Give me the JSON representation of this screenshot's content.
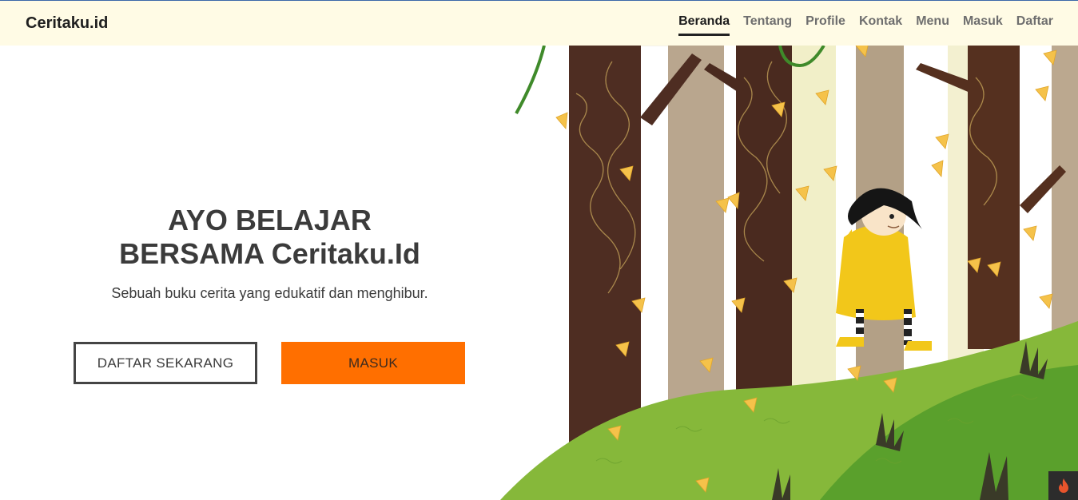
{
  "brand": "Ceritaku.id",
  "nav": {
    "items": [
      {
        "label": "Beranda",
        "active": true
      },
      {
        "label": "Tentang"
      },
      {
        "label": "Profile"
      },
      {
        "label": "Kontak"
      },
      {
        "label": "Menu"
      },
      {
        "label": "Masuk"
      },
      {
        "label": "Daftar"
      }
    ]
  },
  "hero": {
    "title_line1": "AYO BELAJAR",
    "title_line2": "BERSAMA Ceritaku.Id",
    "subtitle": "Sebuah buku cerita yang edukatif dan menghibur.",
    "btn_register": "DAFTAR SEKARANG",
    "btn_login": "MASUK"
  },
  "colors": {
    "navbar_bg": "#fffbe5",
    "accent_orange": "#ff6f00",
    "text_dark": "#3b3b3b"
  },
  "illustration": {
    "icon": "forest-girl-illustration"
  },
  "fab_icon": "flame-icon"
}
